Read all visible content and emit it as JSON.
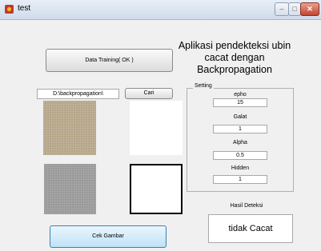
{
  "window": {
    "title": "test",
    "controls": {
      "minimize": "–",
      "maximize": "□",
      "close": "✕"
    }
  },
  "app_title": [
    "Aplikasi pendekteksi ubin",
    "cacat dengan",
    "Backpropagation"
  ],
  "buttons": {
    "data_training": "Data Training( OK )",
    "cari": "Cari",
    "cek_gambar": "Cek Gambar"
  },
  "path_field": {
    "value": "D:\\backpropagation\\"
  },
  "setting": {
    "title": "Setting",
    "epho_label": "epho",
    "epho_value": "15",
    "galat_label": "Galat",
    "galat_value": "1",
    "alpha_label": "Alpha",
    "alpha_value": "0.5",
    "hidden_label": "Hidden",
    "hidden_value": "1"
  },
  "result": {
    "label": "Hasil Deteksi",
    "value": "tidak Cacat"
  },
  "icons": {
    "app": "app-icon"
  }
}
